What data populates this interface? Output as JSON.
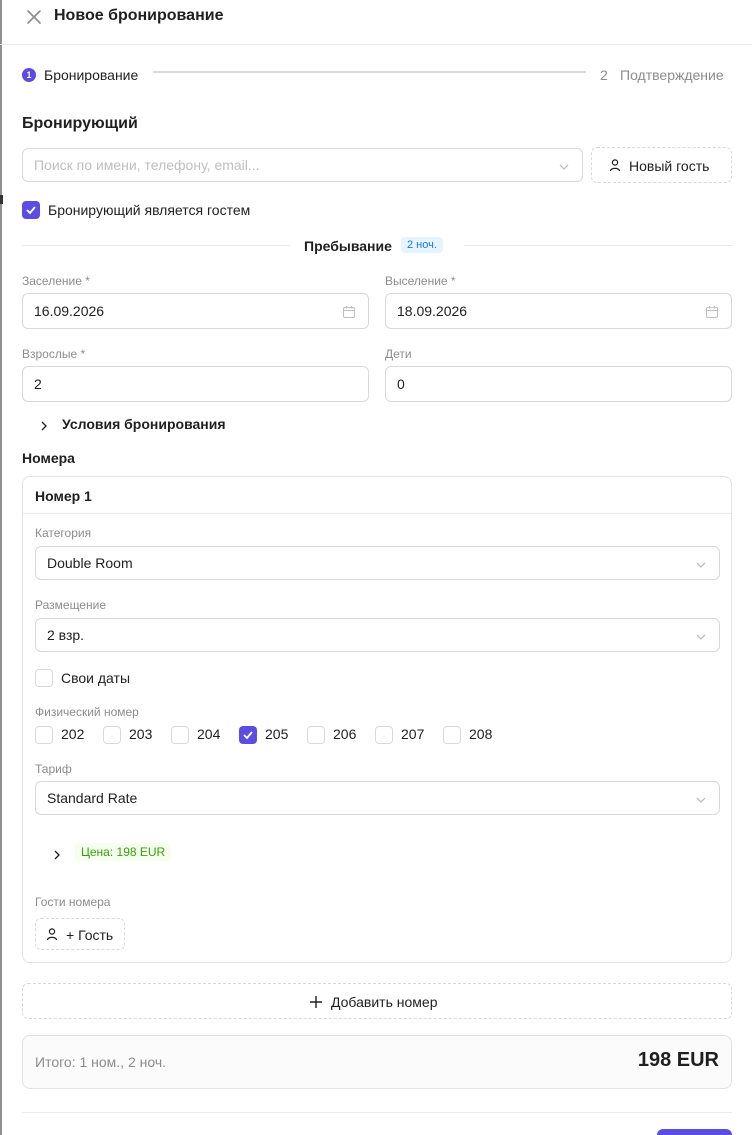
{
  "header": {
    "title": "Новое бронирование"
  },
  "steps": {
    "step1": {
      "number": "1",
      "label": "Бронирование"
    },
    "step2": {
      "number": "2",
      "label": "Подтверждение"
    }
  },
  "booker": {
    "title": "Бронирующий",
    "search_placeholder": "Поиск по имени, телефону, email...",
    "new_guest_label": "Новый гость",
    "is_guest_label": "Бронирующий является гостем",
    "is_guest_checked": true
  },
  "stay": {
    "title": "Пребывание",
    "nights": "2 ноч.",
    "checkin_label": "Заселение *",
    "checkin_value": "16.09.2026",
    "checkout_label": "Выселение *",
    "checkout_value": "18.09.2026",
    "adults_label": "Взрослые *",
    "adults_value": "2",
    "children_label": "Дети",
    "children_value": "0"
  },
  "conditions": {
    "label": "Условия бронирования"
  },
  "rooms": {
    "title": "Номера",
    "room1": {
      "title": "Номер 1",
      "category_label": "Категория",
      "category_value": "Double Room",
      "placement_label": "Размещение",
      "placement_value": "2 взр.",
      "own_dates_label": "Свои даты",
      "physical_label": "Физический номер",
      "physical_rooms": [
        {
          "num": "202",
          "checked": false
        },
        {
          "num": "203",
          "checked": false
        },
        {
          "num": "204",
          "checked": false
        },
        {
          "num": "205",
          "checked": true
        },
        {
          "num": "206",
          "checked": false
        },
        {
          "num": "207",
          "checked": false
        },
        {
          "num": "208",
          "checked": false
        }
      ],
      "tariff_label": "Тариф",
      "tariff_value": "Standard Rate",
      "price_label": "Цена: 198 EUR",
      "guests_label": "Гости номера",
      "add_guest_label": "+ Гость"
    },
    "add_room_label": "Добавить номер"
  },
  "totals": {
    "summary": "Итого: 1 ном., 2 ноч.",
    "amount": "198 EUR"
  },
  "colors": {
    "accent": "#5b4de1",
    "tag_blue": "#1677d4",
    "tag_green": "#389e0d"
  }
}
